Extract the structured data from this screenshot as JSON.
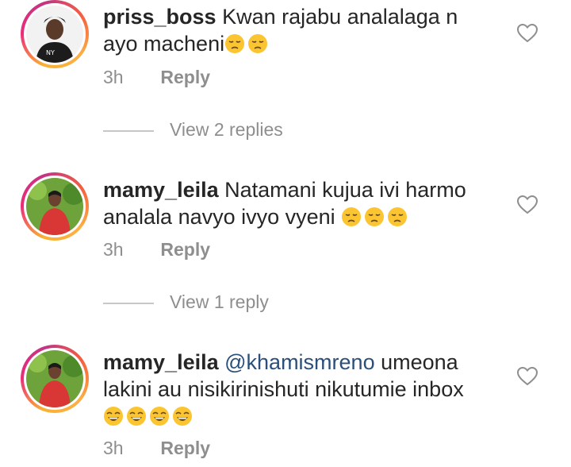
{
  "comments": [
    {
      "username": "priss_boss",
      "text_line1": "Kwan rajabu  analalaga n",
      "text_line2": "ayo macheni",
      "emojis": [
        "sad-face-icon",
        "sad-face-icon"
      ],
      "time": "3h",
      "reply_label": "Reply",
      "view_replies": "View 2 replies"
    },
    {
      "username": "mamy_leila",
      "text_line1": "Natamani kujua ivi harmo",
      "text_line2": "analala navyo ivyo vyeni",
      "emojis": [
        "sad-face-icon",
        "sad-face-icon",
        "sad-face-icon"
      ],
      "time": "3h",
      "reply_label": "Reply",
      "view_replies": "View 1 reply"
    },
    {
      "username": "mamy_leila",
      "mention": "@khamismreno",
      "text_line1": " umeona",
      "text_line2": "lakini au nisikirinishuti nikutumie inbox",
      "emojis": [
        "laughing-face-icon",
        "laughing-face-icon",
        "laughing-face-icon",
        "laughing-face-icon"
      ],
      "time": "3h",
      "reply_label": "Reply"
    }
  ],
  "colors": {
    "text": "#262626",
    "muted": "#8e8e8e",
    "mention": "#2a4f7a",
    "story_ring": [
      "#f9b233",
      "#ee2a7b",
      "#c13584"
    ]
  }
}
